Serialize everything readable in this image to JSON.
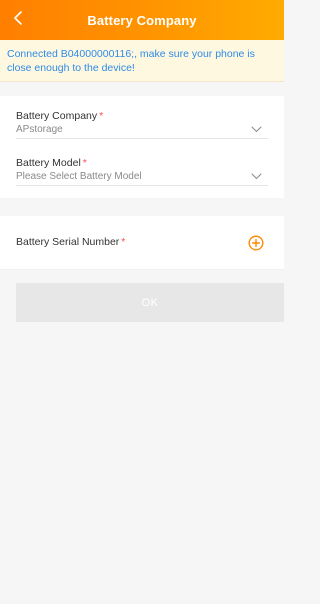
{
  "header": {
    "title": "Battery Company",
    "back_icon": "chevron-left-icon",
    "gradient": [
      "#ff7f00",
      "#ffab00"
    ]
  },
  "banner": {
    "text": "Connected  B04000000116;, make sure your phone is close enough to the device!",
    "color": "#2d8be8",
    "background": "#fff8e1"
  },
  "form": {
    "battery_company": {
      "label": "Battery Company",
      "required_mark": "*",
      "value": "APstorage",
      "icon": "chevron-down-icon"
    },
    "battery_model": {
      "label": "Battery Model",
      "required_mark": "*",
      "placeholder": "Please Select Battery Model",
      "icon": "chevron-down-icon"
    },
    "battery_serial": {
      "label": "Battery Serial Number",
      "required_mark": "*",
      "add_icon": "plus-circle-icon"
    }
  },
  "actions": {
    "ok_label": "OK",
    "ok_disabled": true
  },
  "colors": {
    "accent": "#ff8a00",
    "required": "#ff4d4f",
    "page_background": "#f6f6f6"
  }
}
